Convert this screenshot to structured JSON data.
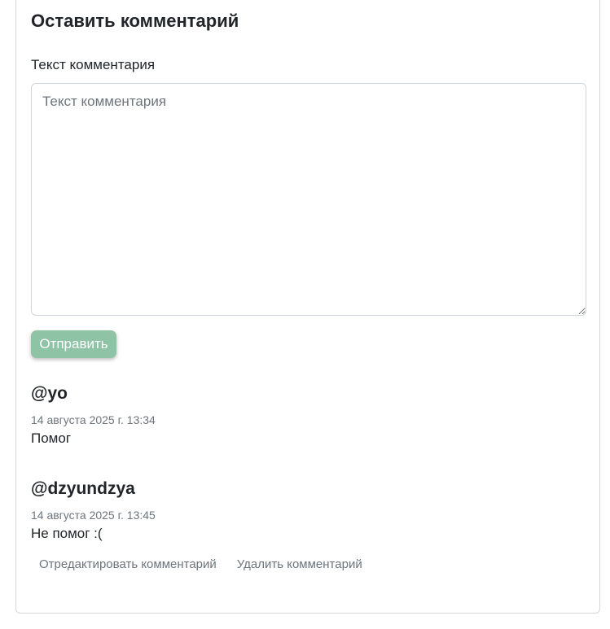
{
  "form": {
    "heading": "Оставить комментарий",
    "field_label": "Текст комментария",
    "textarea_placeholder": "Текст комментария",
    "textarea_value": "",
    "submit_label": "Отправить",
    "submit_color": "#8fc3a5"
  },
  "comments": [
    {
      "author": "@yo",
      "date": "14 августа 2025 г. 13:34",
      "text": "Помог"
    },
    {
      "author": "@dzyundzya",
      "date": "14 августа 2025 г. 13:45",
      "text": "Не помог :(",
      "actions": {
        "edit_label": "Отредактировать комментарий",
        "delete_label": "Удалить комментарий"
      }
    }
  ]
}
